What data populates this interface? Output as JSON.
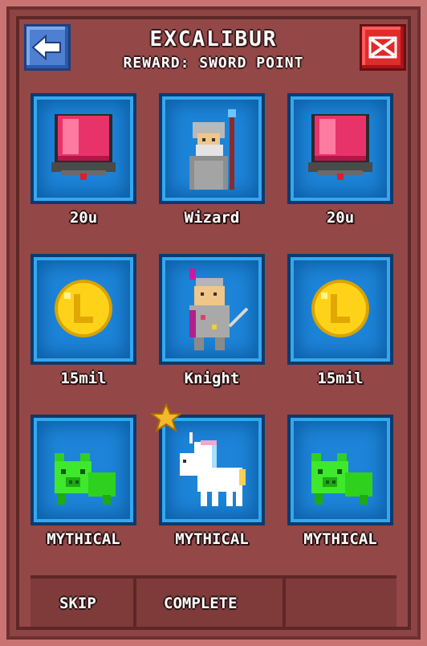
{
  "header": {
    "title": "EXCALIBUR",
    "subtitle": "REWARD: SWORD POINT"
  },
  "slots": [
    {
      "label": "20u",
      "icon": "ruby-gem-icon"
    },
    {
      "label": "Wizard",
      "icon": "wizard-character-icon"
    },
    {
      "label": "20u",
      "icon": "ruby-gem-icon"
    },
    {
      "label": "15mil",
      "icon": "gold-coin-icon"
    },
    {
      "label": "Knight",
      "icon": "knight-character-icon"
    },
    {
      "label": "15mil",
      "icon": "gold-coin-icon"
    },
    {
      "label": "MYTHICAL",
      "icon": "green-pig-icon"
    },
    {
      "label": "MYTHICAL",
      "icon": "white-unicorn-icon",
      "starred": true
    },
    {
      "label": "MYTHICAL",
      "icon": "green-pig-icon"
    }
  ],
  "footer": {
    "skip_label": "SKIP",
    "complete_label": "COMPLETE"
  },
  "colors": {
    "panel": "#934747",
    "slot": "#1d84d8",
    "back_button": "#4f7fd0",
    "close_button": "#e02b2b",
    "star": "#f5b82a"
  }
}
